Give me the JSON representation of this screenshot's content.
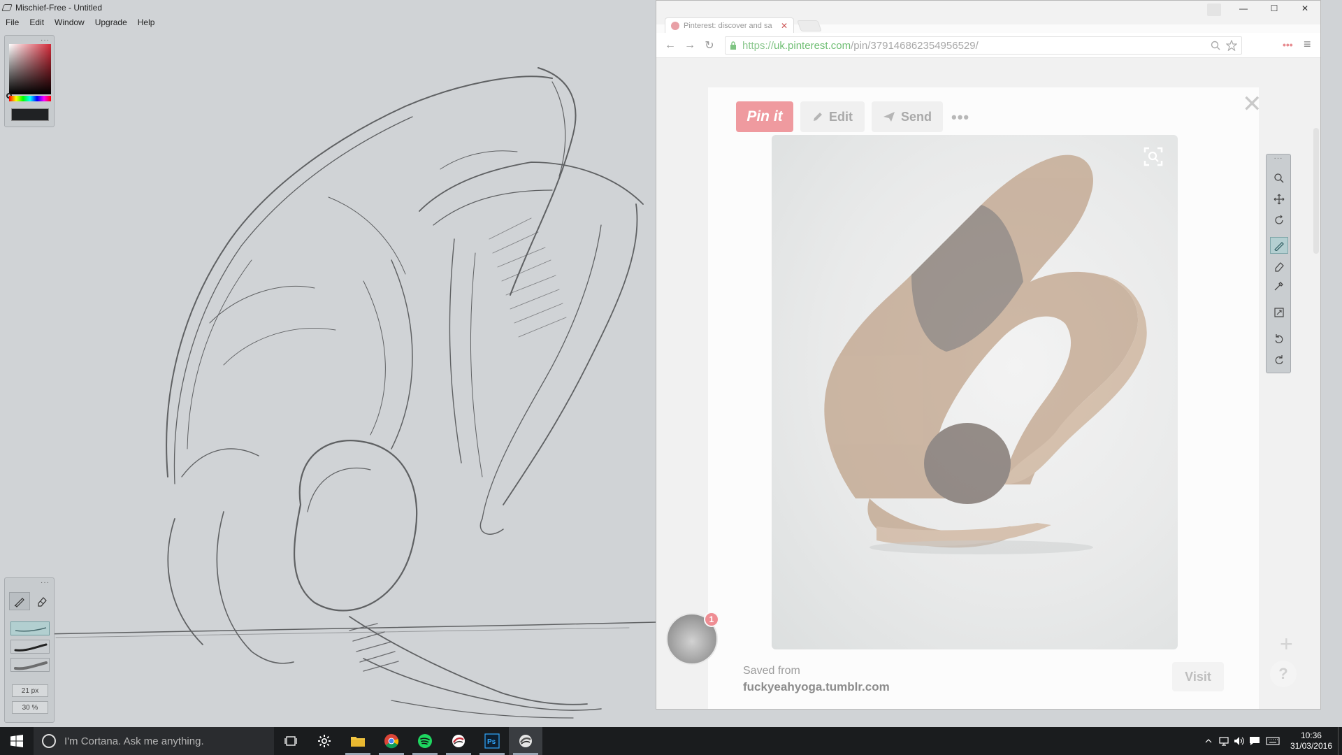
{
  "app": {
    "title": "Mischief-Free - Untitled",
    "menu": [
      "File",
      "Edit",
      "Window",
      "Upgrade",
      "Help"
    ],
    "brush_size": "21 px",
    "brush_opacity": "30 %",
    "current_color": "#202224",
    "panel_grip": "···"
  },
  "browser": {
    "tab_title": "Pinterest: discover and sa",
    "url_scheme": "https://",
    "url_host": "uk.pinterest.com",
    "url_path": "/pin/379146862354956529/"
  },
  "pin": {
    "pinit_label": "Pin it",
    "edit_label": "Edit",
    "send_label": "Send",
    "more_label": "•••",
    "saved_from_label": "Saved from",
    "saved_from_source": "fuckyeahyoga.tumblr.com",
    "visit_label": "Visit",
    "notification_count": "1",
    "close_label": "✕",
    "plus_label": "+",
    "help_label": "?"
  },
  "taskbar": {
    "cortana_placeholder": "I'm Cortana. Ask me anything.",
    "time": "10:36",
    "date": "31/03/2016"
  },
  "colors": {
    "pinterest_red": "#ef9a9f",
    "canvas_bg": "#d0d3d6",
    "taskbar_bg": "#1a1c1e"
  }
}
